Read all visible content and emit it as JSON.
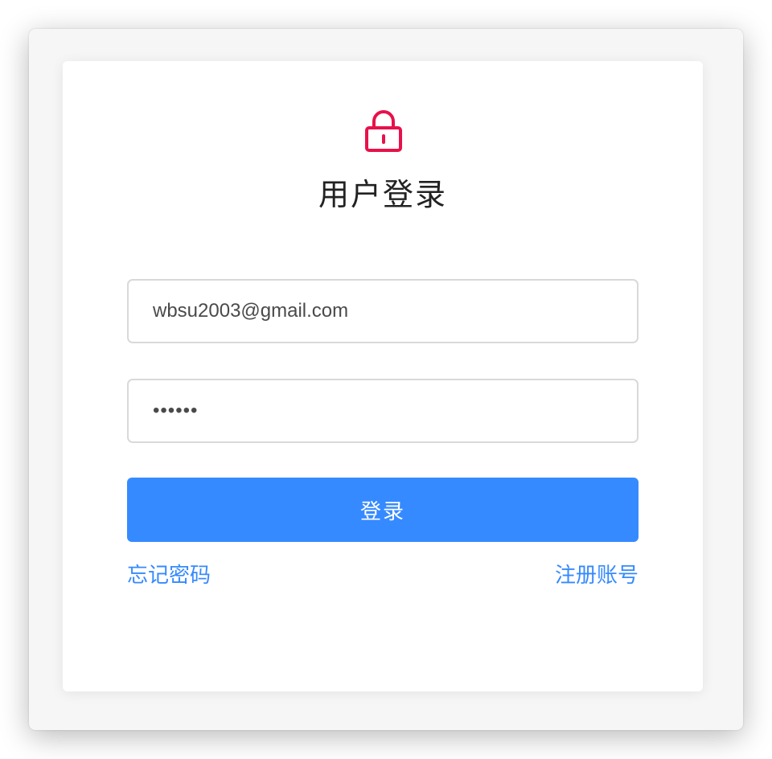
{
  "icon": {
    "name": "lock-icon",
    "color": "#e8114a"
  },
  "title": "用户登录",
  "email": {
    "value": "wbsu2003@gmail.com"
  },
  "password": {
    "value": "••••••"
  },
  "buttons": {
    "login_label": "登录"
  },
  "links": {
    "forgot_password": "忘记密码",
    "register": "注册账号"
  },
  "colors": {
    "accent": "#368aff",
    "icon": "#e8114a",
    "title": "#222222"
  }
}
